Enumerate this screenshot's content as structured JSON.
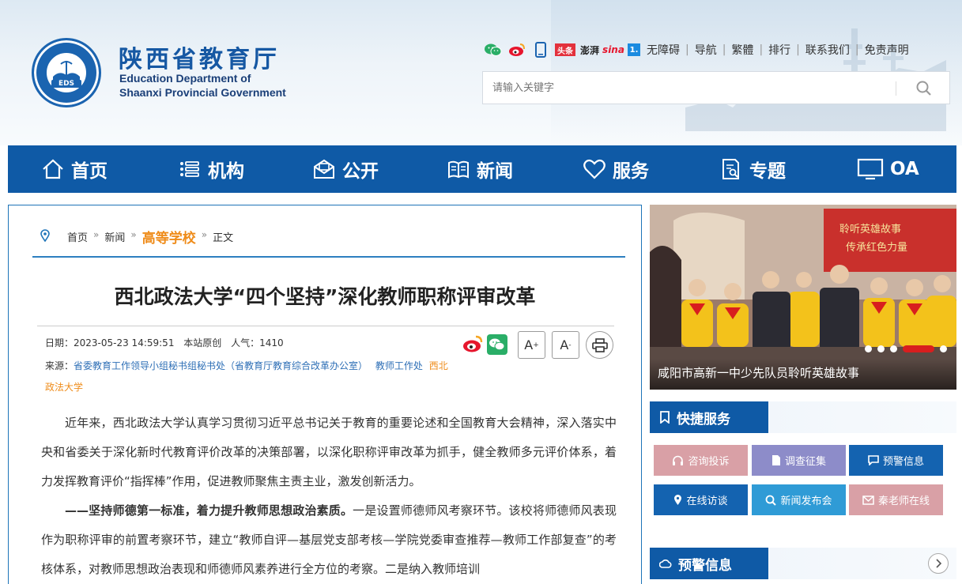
{
  "site": {
    "title_cn": "陕西省教育厅",
    "title_en_1": "Education Department of",
    "title_en_2": "Shaanxi Provincial Government",
    "logo_text": "EDUCATION DEPARTMENT OF SHAANXI",
    "logo_abbr": "EDS",
    "logo_cn": "陕西省教育厅"
  },
  "social": [
    {
      "name": "wechat-icon",
      "color": "#2aae67"
    },
    {
      "name": "weibo-icon",
      "color": "#e6162d"
    },
    {
      "name": "mobile-icon",
      "color": "#1b64b0"
    },
    {
      "name": "toutiao-icon",
      "label": "头条",
      "color": "#e3313c"
    },
    {
      "name": "thepaper-icon",
      "label": "澎湃",
      "color": "#222222"
    },
    {
      "name": "sina-icon",
      "label": "sina",
      "color": "#e6162d"
    },
    {
      "name": "yidian-icon",
      "label": "1.",
      "color": "#1b8be0"
    }
  ],
  "toplinks": [
    "无障碍",
    "导航",
    "繁體",
    "排行",
    "联系我们",
    "免责声明"
  ],
  "search": {
    "placeholder": "请输入关键字"
  },
  "nav": [
    "首页",
    "机构",
    "公开",
    "新闻",
    "服务",
    "专题",
    "OA"
  ],
  "breadcrumb": {
    "home": "首页",
    "news": "新闻",
    "section": "高等学校",
    "current": "正文"
  },
  "article": {
    "title": "西北政法大学“四个坚持”深化教师职称评审改革",
    "date_label": "日期：2023-05-23 14:59:51",
    "original_label": "本站原创",
    "views_label": "人气：1410",
    "source_label": "来源：",
    "sources": [
      "省委教育工作领导小组秘书组秘书处（省教育厅教育综合改革办公室）",
      "教师工作处"
    ],
    "source_highlight": "西北政法大学",
    "font_bigger": "A",
    "font_smaller": "A",
    "para1": "近年来，西北政法大学认真学习贯彻习近平总书记关于教育的重要论述和全国教育大会精神，深入落实中央和省委关于深化新时代教育评价改革的决策部署，以深化职称评审改革为抓手，健全教师多元评价体系，着力发挥教育评价“指挥棒”作用，促进教师聚焦主责主业，激发创新活力。",
    "para2_bold": "——坚持师德第一标准，着力提升教师思想政治素质。",
    "para2": "一是设置师德师风考察环节。该校将师德师风表现作为职称评审的前置考察环节，建立“教师自评—基层党支部考核—学院党委审查推荐—教师工作部复查”的考核体系，对教师思想政治表现和师德师风素养进行全方位的考察。二是纳入教师培训"
  },
  "slider": {
    "caption": "咸阳市高新一中少先队员聆听英雄故事",
    "banner_line1": "聆听英雄故事",
    "banner_line2": "传承红色力量",
    "active_index": 4
  },
  "quick": {
    "title": "快捷服务",
    "items": [
      {
        "label": "咨询投诉",
        "color": "#d9a0a6",
        "icon": "headset-icon"
      },
      {
        "label": "调查征集",
        "color": "#8d8cc9",
        "icon": "document-icon"
      },
      {
        "label": "预警信息",
        "color": "#1463b0",
        "icon": "message-icon"
      },
      {
        "label": "在线访谈",
        "color": "#1463b0",
        "icon": "location-icon"
      },
      {
        "label": "新闻发布会",
        "color": "#2f9bd6",
        "icon": "search-icon"
      },
      {
        "label": "秦老师在线",
        "color": "#d9a0a6",
        "icon": "mail-icon"
      }
    ]
  },
  "warning": {
    "title": "预警信息"
  }
}
